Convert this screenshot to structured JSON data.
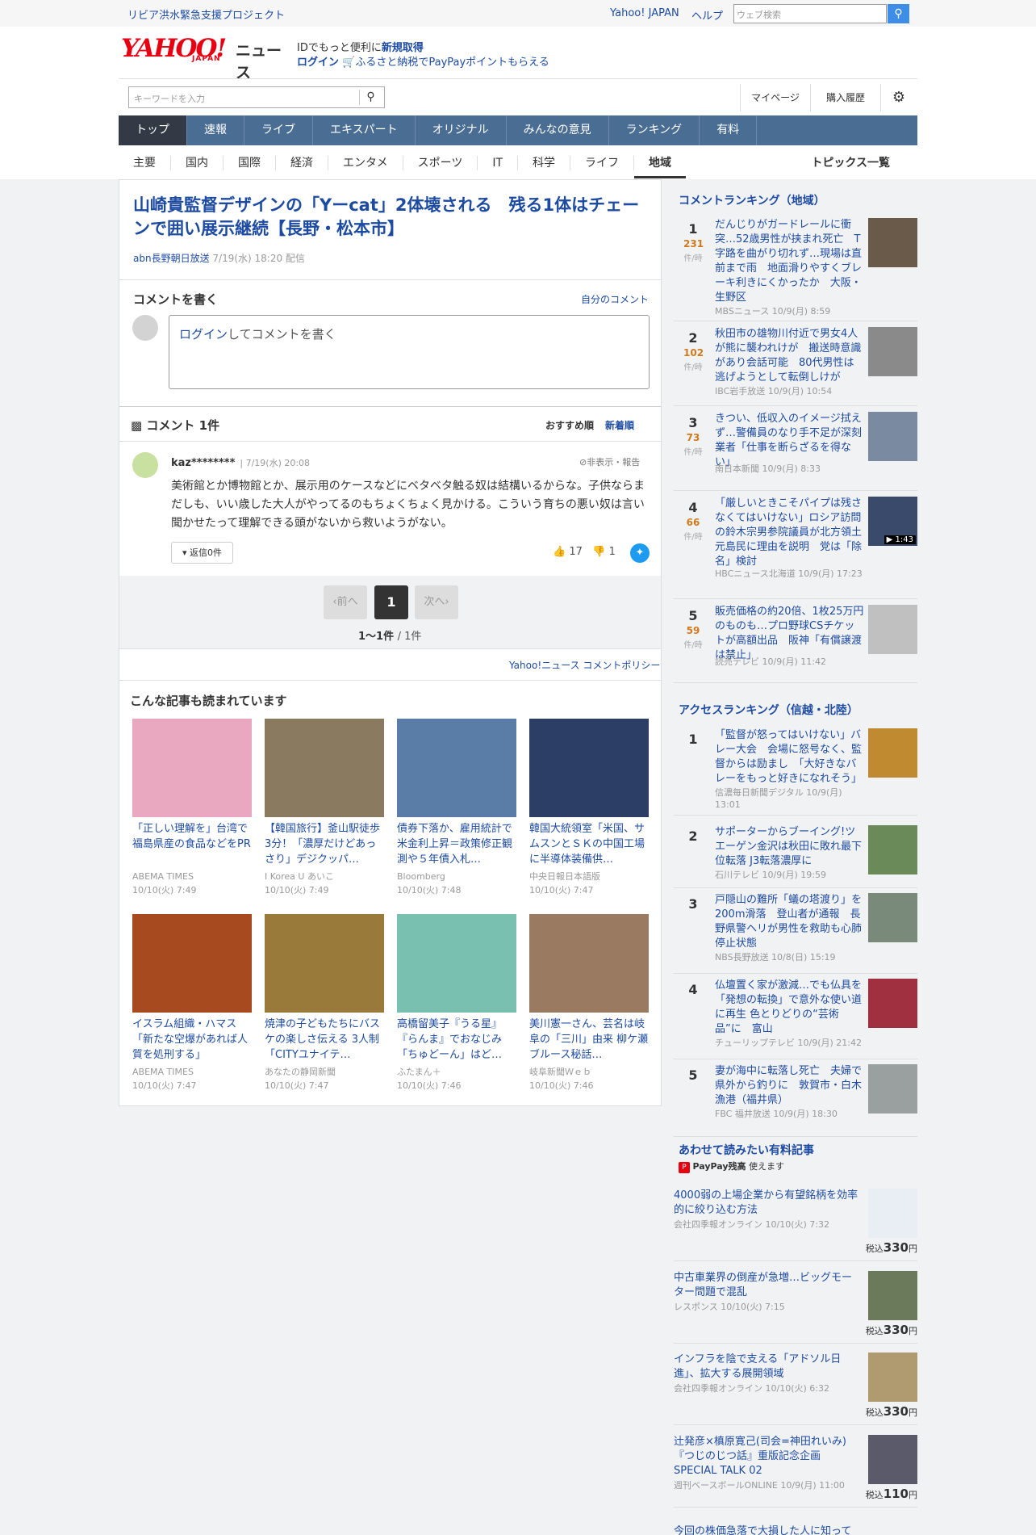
{
  "header": {
    "promo": "リビア洪水緊急支援プロジェクト",
    "yahoo_japan": "Yahoo! JAPAN",
    "help": "ヘルプ",
    "web_search_placeholder": "ウェブ検索",
    "logo_text": "YAHOO!",
    "logo_sub": "JAPAN",
    "logo_news": "ニュース",
    "id_prefix": "IDでもっと便利に",
    "id_link": "新規取得",
    "login": "ログイン",
    "furusato": "ふるさと納税でPayPayポイントもらえる",
    "keyword_placeholder": "キーワードを入力",
    "mypage": "マイページ",
    "purchase": "購入履歴"
  },
  "nav": [
    "トップ",
    "速報",
    "ライブ",
    "エキスパート",
    "オリジナル",
    "みんなの意見",
    "ランキング",
    "有料"
  ],
  "subnav": [
    "主要",
    "国内",
    "国際",
    "経済",
    "エンタメ",
    "スポーツ",
    "IT",
    "科学",
    "ライフ",
    "地域"
  ],
  "topics": "トピックス一覧",
  "article": {
    "title": "山崎貴監督デザインの「Yーcat」2体壊される　残る1体はチェーンで囲い展示継続【長野・松本市】",
    "source": "abn長野朝日放送",
    "date": "7/19(水) 18:20 配信"
  },
  "write": {
    "heading": "コメントを書く",
    "my_comment": "自分のコメント",
    "login_link": "ログイン",
    "login_rest": "してコメントを書く"
  },
  "comments": {
    "heading": "コメント 1件",
    "sort_rec": "おすすめ順",
    "sort_new": "新着順",
    "user": "kaz********",
    "time": "7/19(水) 20:08",
    "hide": "非表示・報告",
    "body": "美術館とか博物館とか、展示用のケースなどにベタベタ触る奴は結構いるからな。子供ならまだしも、いい歳した大人がやってるのもちょくちょく見かける。こういう育ちの悪い奴は言い聞かせたって理解できる頭がないから救いようがない。",
    "reply": "返信0件",
    "likes": "17",
    "dislikes": "1"
  },
  "pager": {
    "prev": "前へ",
    "page": "1",
    "next": "次へ",
    "range": "1〜1件",
    "total": "/ 1件"
  },
  "policy": "Yahoo!ニュース コメントポリシー",
  "also_heading": "こんな記事も読まれています",
  "cards": [
    {
      "t": "「正しい理解を」台湾で福島県産の食品などをPR",
      "s": "ABEMA TIMES",
      "d": "10/10(火) 7:49",
      "c": "#e9a8c0"
    },
    {
      "t": "【韓国旅行】釜山駅徒歩3分！「濃厚だけどあっさり」デジクッパ…",
      "s": "I Korea U あいこ",
      "d": "10/10(火) 7:49",
      "c": "#8a7a60"
    },
    {
      "t": "債券下落か、雇用統計で米金利上昇＝政策修正観測や５年債入札…",
      "s": "Bloomberg",
      "d": "10/10(火) 7:48",
      "c": "#5a7da8"
    },
    {
      "t": "韓国大統領室「米国、サムスンとＳＫの中国工場に半導体装備供…",
      "s": "中央日報日本語版",
      "d": "10/10(火) 7:47",
      "c": "#2c3e66"
    },
    {
      "t": "イスラム組織・ハマス「新たな空爆があれば人質を処刑する」",
      "s": "ABEMA TIMES",
      "d": "10/10(火) 7:47",
      "c": "#a84a20"
    },
    {
      "t": "焼津の子どもたちにバスケの楽しさ伝える 3人制「CITYユナイテ…",
      "s": "あなたの静岡新聞",
      "d": "10/10(火) 7:47",
      "c": "#9a7a3a"
    },
    {
      "t": "高橋留美子『うる星』『らんま』でおなじみ「ちゅどーん」はど…",
      "s": "ふたまん＋",
      "d": "10/10(火) 7:46",
      "c": "#7ac0b0"
    },
    {
      "t": "美川憲一さん、芸名は岐阜の「三川」由来 柳ケ瀬ブルース秘話…",
      "s": "岐阜新聞Ｗｅｂ",
      "d": "10/10(火) 7:46",
      "c": "#9a7a60"
    }
  ],
  "comment_ranking": {
    "heading": "コメントランキング（地域）",
    "unit": "件/時",
    "items": [
      {
        "n": "1",
        "c": "231",
        "t": "だんじりがガードレールに衝突…52歳男性が挟まれ死亡　T字路を曲がり切れず…現場は直前まで雨　地面滑りやすくブレーキ利きにくかったか　大阪・生野区",
        "s": "MBSニュース 10/9(月) 8:59",
        "col": "#6a5a4a"
      },
      {
        "n": "2",
        "c": "102",
        "t": "秋田市の雄物川付近で男女4人が熊に襲われけが　搬送時意識があり会話可能　80代男性は逃げようとして転倒しけが",
        "s": "IBC岩手放送 10/9(月) 10:54",
        "col": "#8a8a8a"
      },
      {
        "n": "3",
        "c": "73",
        "t": "きつい、低収入のイメージ拭えず…警備員のなり手不足が深刻 業者「仕事を断らざるを得ない」",
        "s": "南日本新聞 10/9(月) 8:33",
        "col": "#7a8aa0"
      },
      {
        "n": "4",
        "c": "66",
        "t": "「厳しいときこそパイプは残さなくてはいけない」ロシア訪問の鈴木宗男参院議員が北方領土元島民に理由を説明　党は「除名」検討",
        "s": "HBCニュース北海道 10/9(月) 17:23",
        "col": "#3a4a6a",
        "dur": "1:43"
      },
      {
        "n": "5",
        "c": "59",
        "t": "販売価格の約20倍、1枚25万円のものも…プロ野球CSチケットが高額出品　阪神「有償譲渡は禁止」",
        "s": "読売テレビ 10/9(月) 11:42",
        "col": "#c0c0c0"
      }
    ]
  },
  "access_ranking": {
    "heading": "アクセスランキング（信越・北陸）",
    "items": [
      {
        "n": "1",
        "t": "「監督が怒ってはいけない」バレー大会　会場に怒号なく、監督からは励まし　「大好きなバレーをもっと好きになれそう」",
        "s": "信濃毎日新聞デジタル 10/9(月) 13:01",
        "col": "#c08a30"
      },
      {
        "n": "2",
        "t": "サポーターからブーイング!ツエーゲン金沢は秋田に敗れ最下位転落 J3転落濃厚に",
        "s": "石川テレビ 10/9(月) 19:59",
        "col": "#6a8a5a"
      },
      {
        "n": "3",
        "t": "戸隠山の難所「蟻の塔渡り」を200m滑落　登山者が通報　長野県警ヘリが男性を救助も心肺停止状態",
        "s": "NBS長野放送 10/8(日) 15:19",
        "col": "#7a8a7a"
      },
      {
        "n": "4",
        "t": "仏壇置く家が激減…でも仏具を「発想の転換」で意外な使い道に再生 色とりどりの“芸術品”に　富山",
        "s": "チューリップテレビ 10/9(月) 21:42",
        "col": "#a03040"
      },
      {
        "n": "5",
        "t": "妻が海中に転落し死亡　夫婦で県外から釣りに　敦賀市・白木漁港（福井県）",
        "s": "FBC 福井放送 10/9(月) 18:30",
        "col": "#9aa0a0"
      }
    ]
  },
  "paid": {
    "heading": "あわせて読みたい有料記事",
    "paypay": "PayPay残高",
    "paypay_rest": "使えます",
    "tax": "税込",
    "yen": "円",
    "items": [
      {
        "t": "4000弱の上場企業から有望銘柄を効率的に絞り込む方法",
        "s": "会社四季報オンライン 10/10(火) 7:32",
        "p": "330",
        "col": "#e8eef4"
      },
      {
        "t": "中古車業界の倒産が急増…ビッグモーター問題で混乱",
        "s": "レスポンス 10/10(火) 7:15",
        "p": "330",
        "col": "#6a7a5a"
      },
      {
        "t": "インフラを陰で支える「アドソル日進」、拡大する展開領域",
        "s": "会社四季報オンライン 10/10(火) 6:32",
        "p": "330",
        "col": "#b09a70"
      },
      {
        "t": "辻発彦×槙原寛己(司会=神田れいみ)『つじのじつ話』重版記念企画 SPECIAL TALK 02",
        "s": "週刊ベースボールONLINE 10/9(月) 11:00",
        "p": "110",
        "col": "#5a5a6a"
      },
      {
        "t": "今回の株価急落で大損した人に知って",
        "s": "",
        "p": "",
        "col": "#ddd"
      }
    ]
  }
}
